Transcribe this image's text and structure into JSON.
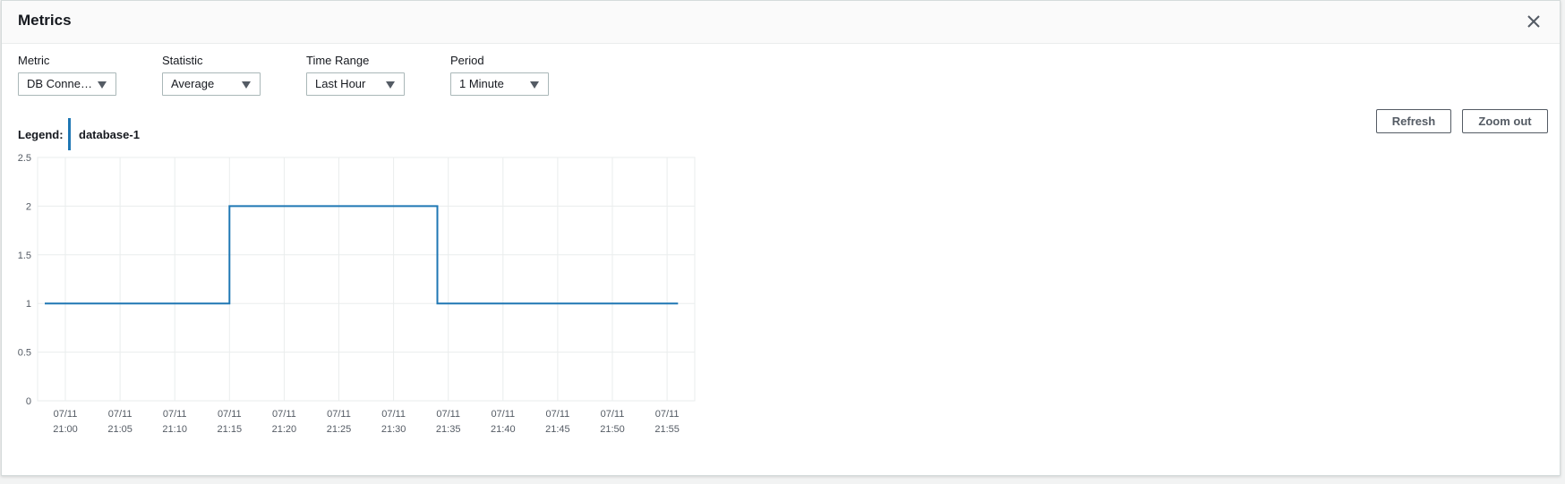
{
  "modal": {
    "title": "Metrics",
    "close_icon": "close-icon"
  },
  "controls": {
    "metric": {
      "label": "Metric",
      "value": "DB Connec…"
    },
    "statistic": {
      "label": "Statistic",
      "value": "Average"
    },
    "time_range": {
      "label": "Time Range",
      "value": "Last Hour"
    },
    "period": {
      "label": "Period",
      "value": "1 Minute"
    }
  },
  "buttons": {
    "refresh": "Refresh",
    "zoom_out": "Zoom out"
  },
  "legend": {
    "label": "Legend:",
    "series": "database-1",
    "color": "#1f77b4"
  },
  "chart_data": {
    "type": "line",
    "step": true,
    "ylim": [
      0,
      2.5
    ],
    "yticks": [
      "0",
      "0.5",
      "1",
      "1.5",
      "2",
      "2.5"
    ],
    "xticks": [
      {
        "date": "07/11",
        "time": "21:00"
      },
      {
        "date": "07/11",
        "time": "21:05"
      },
      {
        "date": "07/11",
        "time": "21:10"
      },
      {
        "date": "07/11",
        "time": "21:15"
      },
      {
        "date": "07/11",
        "time": "21:20"
      },
      {
        "date": "07/11",
        "time": "21:25"
      },
      {
        "date": "07/11",
        "time": "21:30"
      },
      {
        "date": "07/11",
        "time": "21:35"
      },
      {
        "date": "07/11",
        "time": "21:40"
      },
      {
        "date": "07/11",
        "time": "21:45"
      },
      {
        "date": "07/11",
        "time": "21:50"
      },
      {
        "date": "07/11",
        "time": "21:55"
      }
    ],
    "grid": true,
    "series": [
      {
        "name": "database-1",
        "color": "#1f77b4",
        "points": [
          {
            "x": "21:58",
            "y": 1
          },
          {
            "x": "21:15",
            "y": 1
          },
          {
            "x": "21:15",
            "y": 2
          },
          {
            "x": "21:34",
            "y": 2
          },
          {
            "x": "21:34",
            "y": 1
          },
          {
            "x": "21:56",
            "y": 1
          }
        ]
      }
    ]
  }
}
